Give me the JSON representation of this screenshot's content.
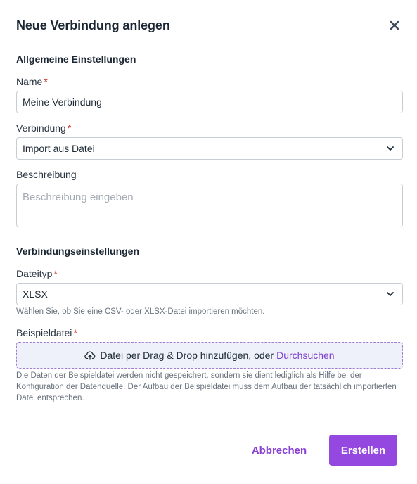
{
  "dialog": {
    "title": "Neue Verbindung anlegen",
    "cancel_label": "Abbrechen",
    "create_label": "Erstellen",
    "accent_color": "#9548e0"
  },
  "general": {
    "heading": "Allgemeine Einstellungen",
    "name_label": "Name",
    "name_value": "Meine Verbindung",
    "connection_label": "Verbindung",
    "connection_value": "Import aus Datei",
    "description_label": "Beschreibung",
    "description_placeholder": "Beschreibung eingeben",
    "required_marker": "*"
  },
  "connection_settings": {
    "heading": "Verbindungseinstellungen",
    "filetype_label": "Dateityp",
    "filetype_value": "XLSX",
    "filetype_help": "Wählen Sie, ob Sie eine CSV- oder XLSX-Datei importieren möchten.",
    "sample_label": "Beispieldatei",
    "dropzone_text": "Datei per Drag & Drop hinzufügen, oder",
    "dropzone_browse": "Durchsuchen",
    "sample_help": "Die Daten der Beispieldatei werden nicht gespeichert, sondern sie dient lediglich als Hilfe bei der Konfiguration der Datenquelle. Der Aufbau der Beispieldatei muss dem Aufbau der tatsächlich importierten Datei entsprechen."
  },
  "icons": {
    "close": "close-icon",
    "chevron": "chevron-down-icon",
    "upload": "cloud-upload-icon"
  }
}
